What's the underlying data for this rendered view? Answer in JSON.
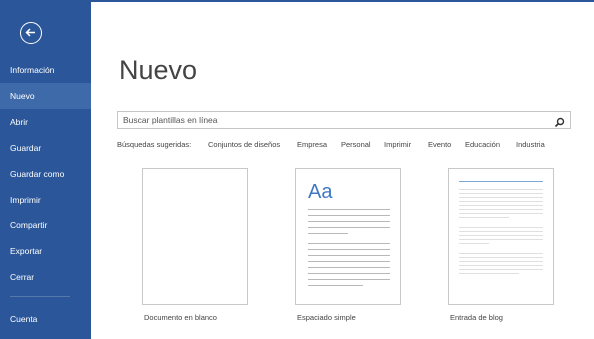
{
  "sidebar": {
    "items": [
      {
        "label": "Información"
      },
      {
        "label": "Nuevo"
      },
      {
        "label": "Abrir"
      },
      {
        "label": "Guardar"
      },
      {
        "label": "Guardar como"
      },
      {
        "label": "Imprimir"
      },
      {
        "label": "Compartir"
      },
      {
        "label": "Exportar"
      },
      {
        "label": "Cerrar"
      },
      {
        "label": "Cuenta"
      }
    ],
    "active": "Nuevo"
  },
  "main": {
    "title": "Nuevo",
    "search": {
      "placeholder": "Buscar plantillas en línea"
    },
    "suggestions": {
      "label": "Búsquedas sugeridas:",
      "items": [
        "Conjuntos de diseños",
        "Empresa",
        "Personal",
        "Imprimir",
        "Evento",
        "Educación",
        "Industria"
      ]
    },
    "templates": [
      {
        "label": "Documento en blanco"
      },
      {
        "label": "Espaciado simple",
        "preview_text": "Aa"
      },
      {
        "label": "Entrada de blog"
      }
    ]
  },
  "colors": {
    "accent": "#2b579a",
    "active_item": "#3f6aa9",
    "preview_heading": "#3f78c4"
  },
  "icons": [
    "back-arrow-icon",
    "search-icon"
  ]
}
